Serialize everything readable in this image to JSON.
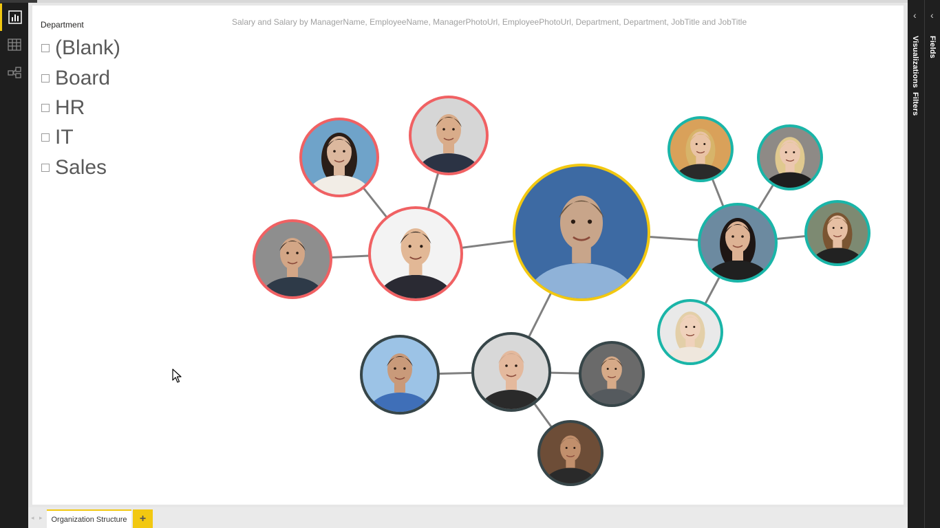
{
  "slicer": {
    "title": "Department",
    "items": [
      "(Blank)",
      "Board",
      "HR",
      "IT",
      "Sales"
    ]
  },
  "visual": {
    "title": "Salary and Salary by ManagerName, EmployeeName, ManagerPhotoUrl, EmployeePhotoUrl, Department, Department, JobTitle and JobTitle"
  },
  "right_pane": {
    "fields": "Fields",
    "visualizations": "Visualizations",
    "filters": "Filters"
  },
  "tabs": {
    "active": "Organization Structure",
    "add": "+"
  },
  "colors": {
    "board": "#f2c811",
    "sales": "#f06163",
    "hr": "#1ab5a8",
    "it": "#374649",
    "link": "#808080"
  },
  "people": [
    {
      "id": "ceo",
      "dept": "board",
      "parent": null,
      "skin": "#c8a58a",
      "hair": "#6a5540",
      "shirt": "#8fb2d8",
      "bg": "#3d6aa3",
      "female": false
    },
    {
      "id": "sales-mgr",
      "dept": "sales",
      "parent": "ceo",
      "skin": "#e2b896",
      "hair": "#2b2420",
      "shirt": "#2a2a33",
      "bg": "#f3f3f3",
      "female": false
    },
    {
      "id": "sales-1",
      "dept": "sales",
      "parent": "sales-mgr",
      "skin": "#dcb89e",
      "hair": "#2a1e18",
      "shirt": "#f2ede6",
      "bg": "#6fa3c9",
      "female": true
    },
    {
      "id": "sales-2",
      "dept": "sales",
      "parent": "sales-mgr",
      "skin": "#d9ac8a",
      "hair": "#3a2818",
      "shirt": "#2b3344",
      "bg": "#d6d6d6",
      "female": false
    },
    {
      "id": "sales-3",
      "dept": "sales",
      "parent": "sales-mgr",
      "skin": "#d3a686",
      "hair": "#231a15",
      "shirt": "#2e3a48",
      "bg": "#8e8e8e",
      "female": false
    },
    {
      "id": "hr-mgr",
      "dept": "hr",
      "parent": "ceo",
      "skin": "#ddb294",
      "hair": "#1e1614",
      "shirt": "#202020",
      "bg": "#6c8aa0",
      "female": true
    },
    {
      "id": "hr-1",
      "dept": "hr",
      "parent": "hr-mgr",
      "skin": "#e9c3a5",
      "hair": "#d7b46a",
      "shirt": "#2a2a2a",
      "bg": "#d9a15a",
      "female": true
    },
    {
      "id": "hr-2",
      "dept": "hr",
      "parent": "hr-mgr",
      "skin": "#ecc8b0",
      "hair": "#e0c98f",
      "shirt": "#1e1e1e",
      "bg": "#8e8a86",
      "female": true
    },
    {
      "id": "hr-3",
      "dept": "hr",
      "parent": "hr-mgr",
      "skin": "#e6bfa3",
      "hair": "#7a5532",
      "shirt": "#222222",
      "bg": "#7d8a72",
      "female": true
    },
    {
      "id": "hr-4",
      "dept": "hr",
      "parent": "hr-mgr",
      "skin": "#f0d2bc",
      "hair": "#e3cfa8",
      "shirt": "#efe7dd",
      "bg": "#e9e9e9",
      "female": true
    },
    {
      "id": "it-mgr",
      "dept": "it",
      "parent": "ceo",
      "skin": "#e4b99d",
      "hair": "#caa58b",
      "shirt": "#2a2a2a",
      "bg": "#d8d8d8",
      "female": false
    },
    {
      "id": "it-1",
      "dept": "it",
      "parent": "it-mgr",
      "skin": "#c99a7a",
      "hair": "#2b2320",
      "shirt": "#3f6fb8",
      "bg": "#9cc3e6",
      "female": false
    },
    {
      "id": "it-2",
      "dept": "it",
      "parent": "it-mgr",
      "skin": "#d6aa88",
      "hair": "#3a2a1d",
      "shirt": "#555a5e",
      "bg": "#6a6a6a",
      "female": false
    },
    {
      "id": "it-3",
      "dept": "it",
      "parent": "it-mgr",
      "skin": "#c18f6c",
      "hair": "#8c6a50",
      "shirt": "#2a2a2a",
      "bg": "#6d4d37",
      "female": false
    }
  ]
}
